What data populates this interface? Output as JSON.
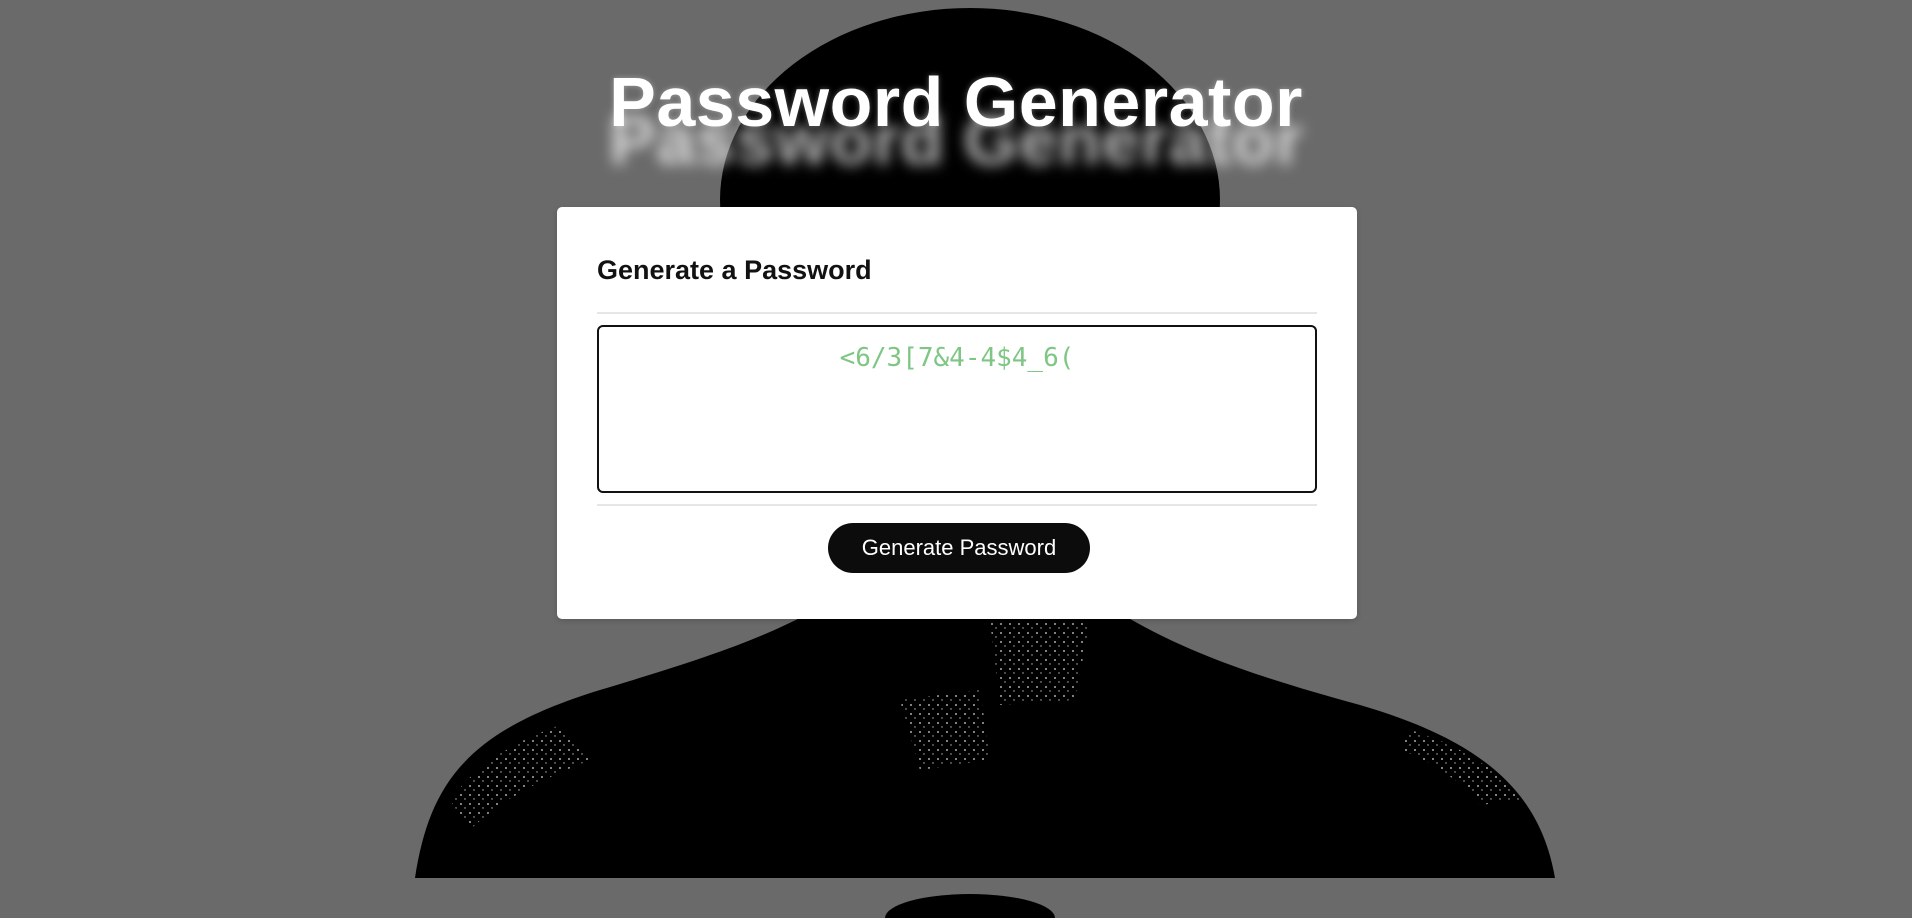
{
  "header": {
    "title": "Password Generator"
  },
  "card": {
    "heading": "Generate a Password",
    "password_value": "<6/3[7&4-4$4_6(",
    "generate_button_label": "Generate Password"
  },
  "colors": {
    "page_background": "#6a6a6a",
    "silhouette": "#000000",
    "password_text": "#7fc685",
    "button_background": "#0c0c0c"
  },
  "background": {
    "image": "person-silhouette"
  }
}
